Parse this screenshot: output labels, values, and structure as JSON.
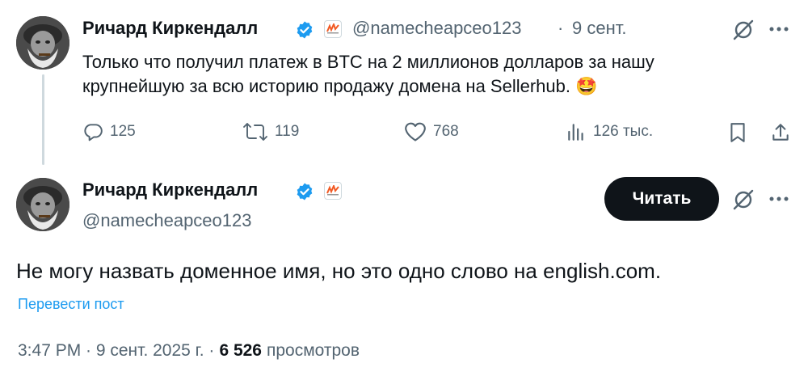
{
  "reply_tweet": {
    "author_name": "Ричард Киркендалл",
    "handle": "@namecheapceo123",
    "separator": "·",
    "time": "9 сент.",
    "text": "Только что получил платеж в BTC на 2 миллионов долларов за нашу крупнейшую за всю историю продажу домена на Sellerhub. 🤩",
    "actions": {
      "replies": "125",
      "reposts": "119",
      "likes": "768",
      "views": "126 тыс."
    },
    "icons": [
      "verified-icon",
      "affiliate-badge-icon",
      "grok-icon",
      "more-icon",
      "reply-icon",
      "repost-icon",
      "like-icon",
      "views-icon",
      "bookmark-icon",
      "share-icon"
    ]
  },
  "main_tweet": {
    "author_name": "Ричард Киркендалл",
    "handle": "@namecheapceo123",
    "follow_label": "Читать",
    "text": "Не могу назвать доменное имя, но это одно слово на english.com.",
    "translate_label": "Перевести пост",
    "timestamp": "3:47 PM · 9 сент. 2025 г. ·",
    "views_count": "6 526",
    "views_label": "просмотров"
  },
  "colors": {
    "accent": "#1d9bf0",
    "verified": "#1d9bf0",
    "muted": "#536471",
    "text": "#0f1419",
    "button": "#0f1419",
    "badge_orange": "#f15a24"
  }
}
